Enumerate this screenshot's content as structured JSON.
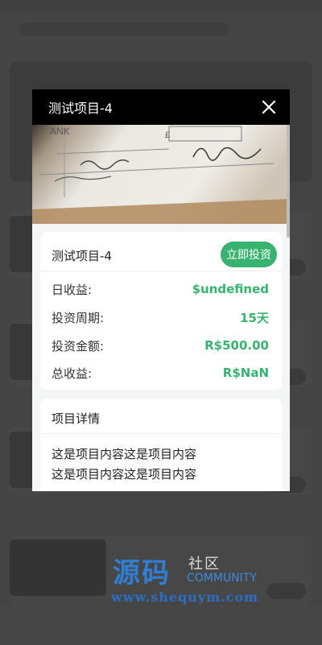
{
  "modal": {
    "title": "测试项目-4",
    "close_icon": "close-icon",
    "hero_image": "bank-check-photo"
  },
  "project": {
    "name": "测试项目-4",
    "invest_button": "立即投资",
    "rows": [
      {
        "label": "日收益:",
        "value": "$undefined"
      },
      {
        "label": "投资周期:",
        "value": "15天"
      },
      {
        "label": "投资金额:",
        "value": "R$500.00"
      },
      {
        "label": "总收益:",
        "value": "R$NaN"
      }
    ]
  },
  "details": {
    "title": "项目详情",
    "lines": [
      "这是项目内容这是项目内容",
      "这是项目内容这是项目内容"
    ]
  },
  "watermark": {
    "main": "源码",
    "she": "社区",
    "community": "COMMUNITY",
    "url": "www.shequym.com"
  },
  "colors": {
    "accent": "#37b36f",
    "header": "#000000"
  }
}
